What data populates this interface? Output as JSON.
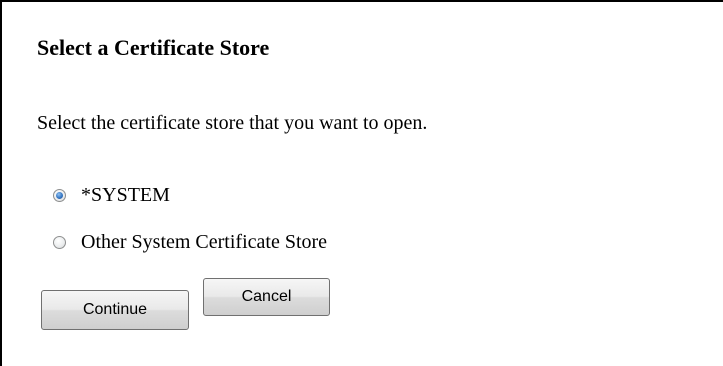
{
  "dialog": {
    "title": "Select a Certificate Store",
    "instructions": "Select the certificate store that you want to open."
  },
  "options": [
    {
      "label": "*SYSTEM",
      "checked": true
    },
    {
      "label": "Other System Certificate Store",
      "checked": false
    }
  ],
  "buttons": {
    "continue_label": "Continue",
    "cancel_label": "Cancel"
  },
  "colors": {
    "text": "#000000",
    "border": "#000000",
    "radio_selected": "#3677c4",
    "button_border": "#707070"
  },
  "icons": {
    "radio_selected": "radio-selected-icon",
    "radio_unselected": "radio-unselected-icon"
  }
}
